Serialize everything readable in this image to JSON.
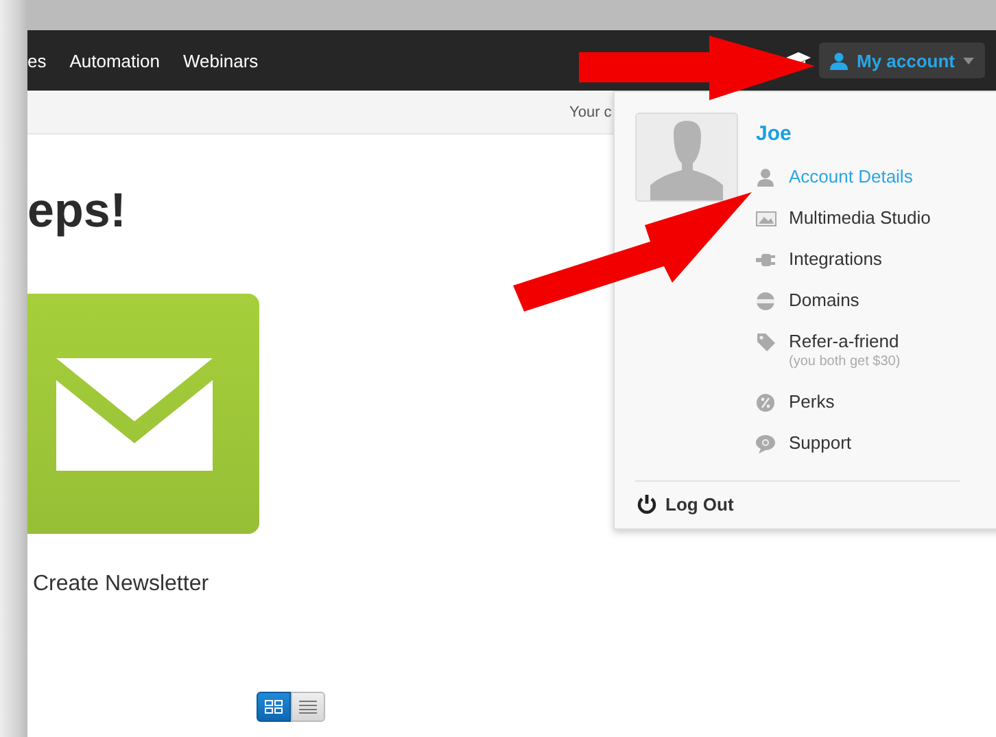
{
  "navbar": {
    "items": [
      "es",
      "Automation",
      "Webinars"
    ],
    "account_button": {
      "label": "My account"
    }
  },
  "notice": {
    "text": "Your c"
  },
  "heading": "eps!",
  "tile": {
    "label": "Create Newsletter"
  },
  "view_toggle": [
    {
      "kind": "grid",
      "selected": true
    },
    {
      "kind": "list",
      "selected": false
    }
  ],
  "account_menu": {
    "name": "Joe",
    "items": [
      {
        "label": "Account Details",
        "highlighted": true
      },
      {
        "label": "Multimedia Studio",
        "highlighted": false
      },
      {
        "label": "Integrations",
        "highlighted": false
      },
      {
        "label": "Domains",
        "highlighted": false
      },
      {
        "label": "Refer-a-friend",
        "note": "(you both get $30)",
        "highlighted": false
      },
      {
        "label": "Perks",
        "highlighted": false
      },
      {
        "label": "Support",
        "highlighted": false
      }
    ],
    "logout": "Log Out"
  }
}
